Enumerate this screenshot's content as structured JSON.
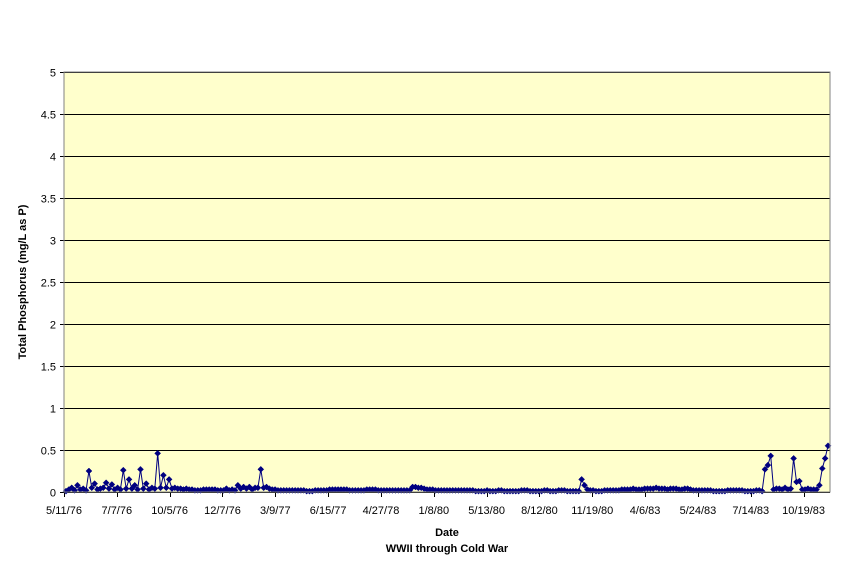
{
  "chart_data": {
    "type": "line",
    "title": "",
    "xlabel": "Date",
    "subtitle": "WWII through Cold War",
    "ylabel": "Total Phosphorus (mg/L as P)",
    "ylim": [
      0,
      5
    ],
    "y_ticks": [
      "0",
      "0.5",
      "1",
      "1.5",
      "2",
      "2.5",
      "3",
      "3.5",
      "4",
      "4.5",
      "5"
    ],
    "x_tick_labels": [
      "5/11/76",
      "7/7/76",
      "10/5/76",
      "12/7/76",
      "3/9/77",
      "6/15/77",
      "4/27/78",
      "1/8/80",
      "5/13/80",
      "8/12/80",
      "11/19/80",
      "4/6/83",
      "5/24/83",
      "7/14/83",
      "10/19/83"
    ],
    "grid": true,
    "legend": "none",
    "plot_background": "#FFFFCC",
    "series_color": "#000080",
    "series": [
      {
        "values": [
          0.01,
          0.03,
          0.05,
          0.02,
          0.08,
          0.03,
          0.04,
          0.02,
          0.25,
          0.05,
          0.1,
          0.03,
          0.04,
          0.05,
          0.11,
          0.04,
          0.09,
          0.03,
          0.05,
          0.03,
          0.26,
          0.04,
          0.15,
          0.04,
          0.08,
          0.03,
          0.27,
          0.04,
          0.1,
          0.03,
          0.05,
          0.04,
          0.46,
          0.05,
          0.2,
          0.05,
          0.15,
          0.04,
          0.05,
          0.04,
          0.04,
          0.03,
          0.04,
          0.03,
          0.03,
          0.02,
          0.02,
          0.02,
          0.03,
          0.03,
          0.03,
          0.03,
          0.03,
          0.02,
          0.02,
          0.02,
          0.04,
          0.02,
          0.03,
          0.02,
          0.08,
          0.04,
          0.06,
          0.04,
          0.06,
          0.03,
          0.05,
          0.05,
          0.27,
          0.05,
          0.06,
          0.04,
          0.03,
          0.03,
          0.02,
          0.02,
          0.02,
          0.02,
          0.02,
          0.02,
          0.02,
          0.02,
          0.02,
          0.02,
          0.01,
          0.01,
          0.01,
          0.02,
          0.02,
          0.02,
          0.02,
          0.02,
          0.03,
          0.03,
          0.03,
          0.03,
          0.03,
          0.03,
          0.03,
          0.02,
          0.02,
          0.02,
          0.02,
          0.02,
          0.02,
          0.03,
          0.03,
          0.03,
          0.03,
          0.02,
          0.02,
          0.02,
          0.02,
          0.02,
          0.02,
          0.02,
          0.02,
          0.02,
          0.02,
          0.02,
          0.02,
          0.06,
          0.06,
          0.05,
          0.05,
          0.04,
          0.03,
          0.03,
          0.03,
          0.02,
          0.02,
          0.02,
          0.02,
          0.02,
          0.02,
          0.02,
          0.02,
          0.02,
          0.02,
          0.02,
          0.02,
          0.02,
          0.02,
          0.01,
          0.01,
          0.01,
          0.01,
          0.02,
          0.01,
          0.01,
          0.01,
          0.02,
          0.02,
          0.01,
          0.01,
          0.01,
          0.01,
          0.01,
          0.01,
          0.02,
          0.02,
          0.02,
          0.01,
          0.01,
          0.01,
          0.01,
          0.01,
          0.02,
          0.02,
          0.01,
          0.01,
          0.01,
          0.02,
          0.02,
          0.02,
          0.01,
          0.01,
          0.01,
          0.01,
          0.01,
          0.15,
          0.08,
          0.03,
          0.02,
          0.02,
          0.01,
          0.01,
          0.01,
          0.02,
          0.02,
          0.02,
          0.02,
          0.02,
          0.02,
          0.03,
          0.03,
          0.03,
          0.03,
          0.04,
          0.03,
          0.03,
          0.03,
          0.04,
          0.04,
          0.04,
          0.04,
          0.05,
          0.04,
          0.04,
          0.04,
          0.03,
          0.04,
          0.04,
          0.04,
          0.03,
          0.03,
          0.04,
          0.04,
          0.03,
          0.02,
          0.02,
          0.02,
          0.02,
          0.02,
          0.02,
          0.02,
          0.01,
          0.01,
          0.01,
          0.01,
          0.01,
          0.02,
          0.02,
          0.02,
          0.02,
          0.02,
          0.02,
          0.01,
          0.01,
          0.01,
          0.01,
          0.02,
          0.02,
          0.01,
          0.27,
          0.32,
          0.43,
          0.03,
          0.04,
          0.04,
          0.03,
          0.05,
          0.03,
          0.04,
          0.4,
          0.12,
          0.13,
          0.03,
          0.03,
          0.04,
          0.03,
          0.03,
          0.03,
          0.08,
          0.28,
          0.4,
          0.55
        ]
      }
    ]
  }
}
